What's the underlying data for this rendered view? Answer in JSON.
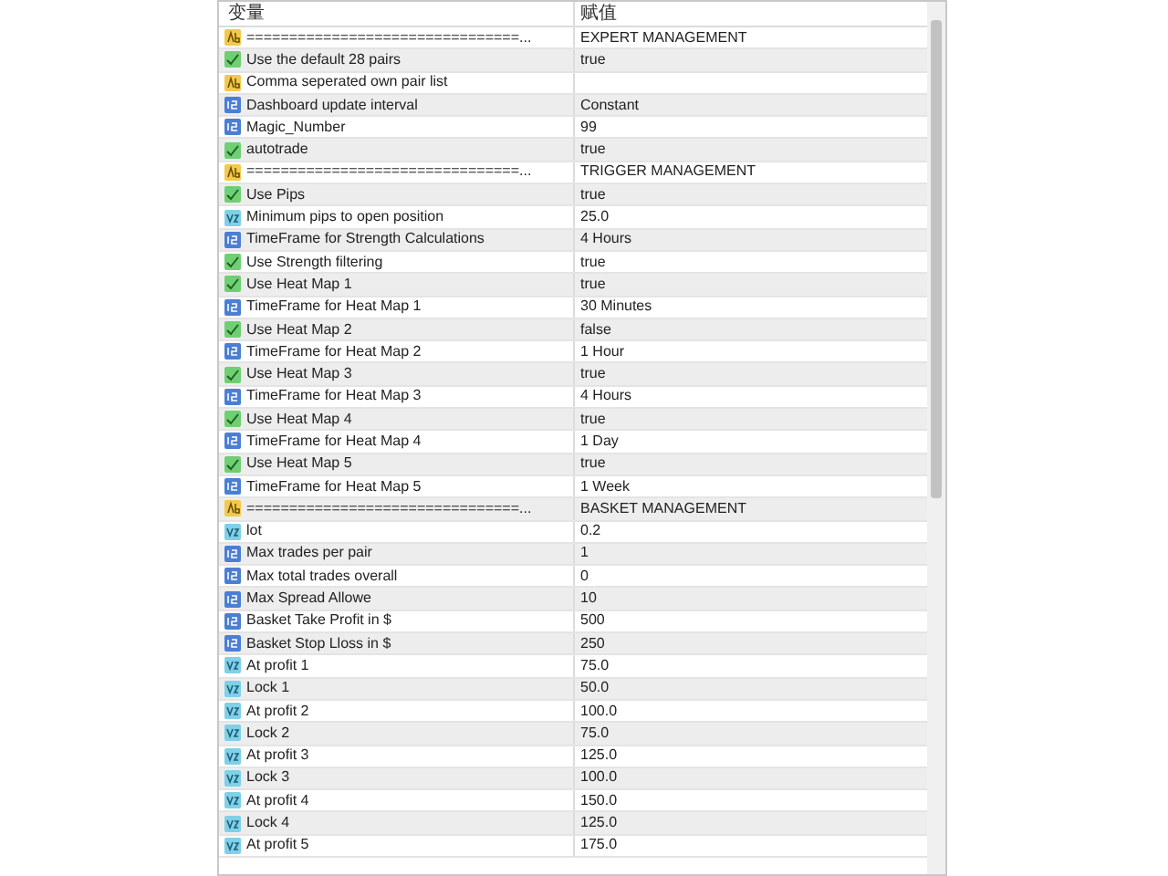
{
  "table": {
    "columns": [
      "变量",
      "赋值"
    ],
    "rows": [
      {
        "kind": "string",
        "name": "================================...",
        "value": "EXPERT MANAGEMENT"
      },
      {
        "kind": "bool",
        "name": "Use the default 28 pairs",
        "value": "true"
      },
      {
        "kind": "string",
        "name": "Comma seperated own pair list"
      },
      {
        "kind": "int",
        "name": "Dashboard update interval",
        "value": "Constant"
      },
      {
        "kind": "int",
        "name": "Magic_Number",
        "value": "99"
      },
      {
        "kind": "bool",
        "name": "autotrade",
        "value": "true"
      },
      {
        "kind": "string",
        "name": "================================...",
        "value": "TRIGGER MANAGEMENT"
      },
      {
        "kind": "bool",
        "name": "Use Pips",
        "value": "true"
      },
      {
        "kind": "double",
        "name": "Minimum pips to open position",
        "value": "25.0"
      },
      {
        "kind": "int",
        "name": "TimeFrame for Strength Calculations",
        "value": "4 Hours"
      },
      {
        "kind": "bool",
        "name": "Use Strength filtering",
        "value": "true"
      },
      {
        "kind": "bool",
        "name": "Use Heat Map 1",
        "value": "true"
      },
      {
        "kind": "int",
        "name": "TimeFrame for Heat Map 1",
        "value": "30 Minutes"
      },
      {
        "kind": "bool",
        "name": "Use Heat Map 2",
        "value": "false"
      },
      {
        "kind": "int",
        "name": "TimeFrame for Heat Map 2",
        "value": "1 Hour"
      },
      {
        "kind": "bool",
        "name": "Use Heat Map 3",
        "value": "true"
      },
      {
        "kind": "int",
        "name": "TimeFrame for Heat Map 3",
        "value": "4 Hours"
      },
      {
        "kind": "bool",
        "name": "Use Heat Map 4",
        "value": "true"
      },
      {
        "kind": "int",
        "name": "TimeFrame for Heat Map 4",
        "value": "1 Day"
      },
      {
        "kind": "bool",
        "name": "Use Heat Map 5",
        "value": "true"
      },
      {
        "kind": "int",
        "name": "TimeFrame for Heat Map 5",
        "value": "1 Week"
      },
      {
        "kind": "string",
        "name": "================================...",
        "value": "BASKET MANAGEMENT"
      },
      {
        "kind": "double",
        "name": "lot",
        "value": "0.2"
      },
      {
        "kind": "int",
        "name": "Max trades per pair",
        "value": "1"
      },
      {
        "kind": "int",
        "name": "Max total trades overall",
        "value": "0"
      },
      {
        "kind": "int",
        "name": "Max Spread Allowe",
        "value": "10"
      },
      {
        "kind": "int",
        "name": "Basket Take Profit in $",
        "value": "500"
      },
      {
        "kind": "int",
        "name": "Basket Stop Lloss in $",
        "value": "250"
      },
      {
        "kind": "double",
        "name": "At profit 1",
        "value": "75.0"
      },
      {
        "kind": "double",
        "name": "Lock 1",
        "value": "50.0"
      },
      {
        "kind": "double",
        "name": "At profit 2",
        "value": "100.0"
      },
      {
        "kind": "double",
        "name": "Lock 2",
        "value": "75.0"
      },
      {
        "kind": "double",
        "name": "At profit 3",
        "value": "125.0"
      },
      {
        "kind": "double",
        "name": "Lock 3",
        "value": "100.0"
      },
      {
        "kind": "double",
        "name": "At profit 4",
        "value": "150.0"
      },
      {
        "kind": "double",
        "name": "Lock 4",
        "value": "125.0"
      },
      {
        "kind": "double",
        "name": "At profit 5",
        "value": "175.0"
      }
    ]
  }
}
